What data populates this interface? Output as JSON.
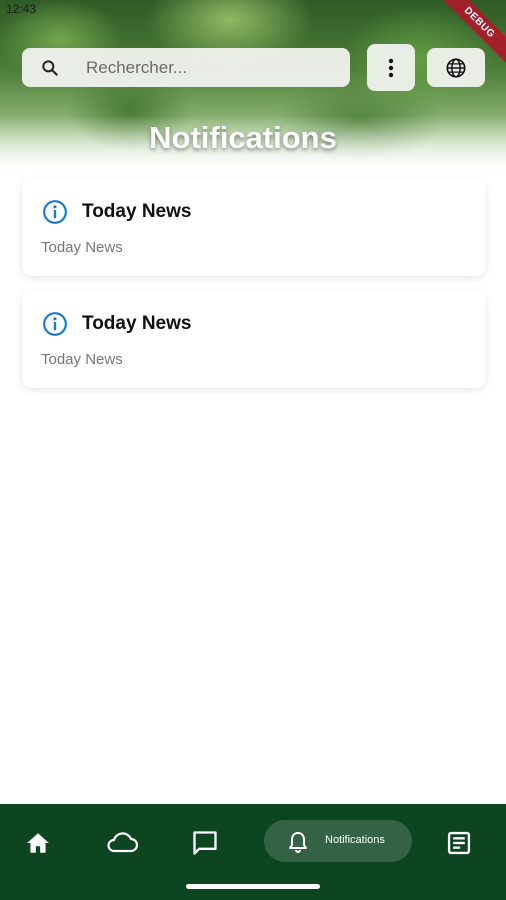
{
  "status": {
    "time": "12:43"
  },
  "debug_banner": "DEBUG",
  "search": {
    "placeholder": "Rechercher..."
  },
  "header": {
    "title": "Notifications"
  },
  "notifications": [
    {
      "title": "Today News",
      "body": "Today News"
    },
    {
      "title": "Today News",
      "body": "Today News"
    }
  ],
  "bottom_nav": {
    "items": [
      {
        "icon": "home-icon"
      },
      {
        "icon": "cloud-icon"
      },
      {
        "icon": "chat-icon"
      },
      {
        "icon": "bell-icon",
        "label": "Notifications",
        "active": true
      },
      {
        "icon": "article-icon"
      }
    ]
  },
  "colors": {
    "nav_background": "#0e4521",
    "info_icon": "#1976d2",
    "debug_ribbon": "#a3202a"
  }
}
